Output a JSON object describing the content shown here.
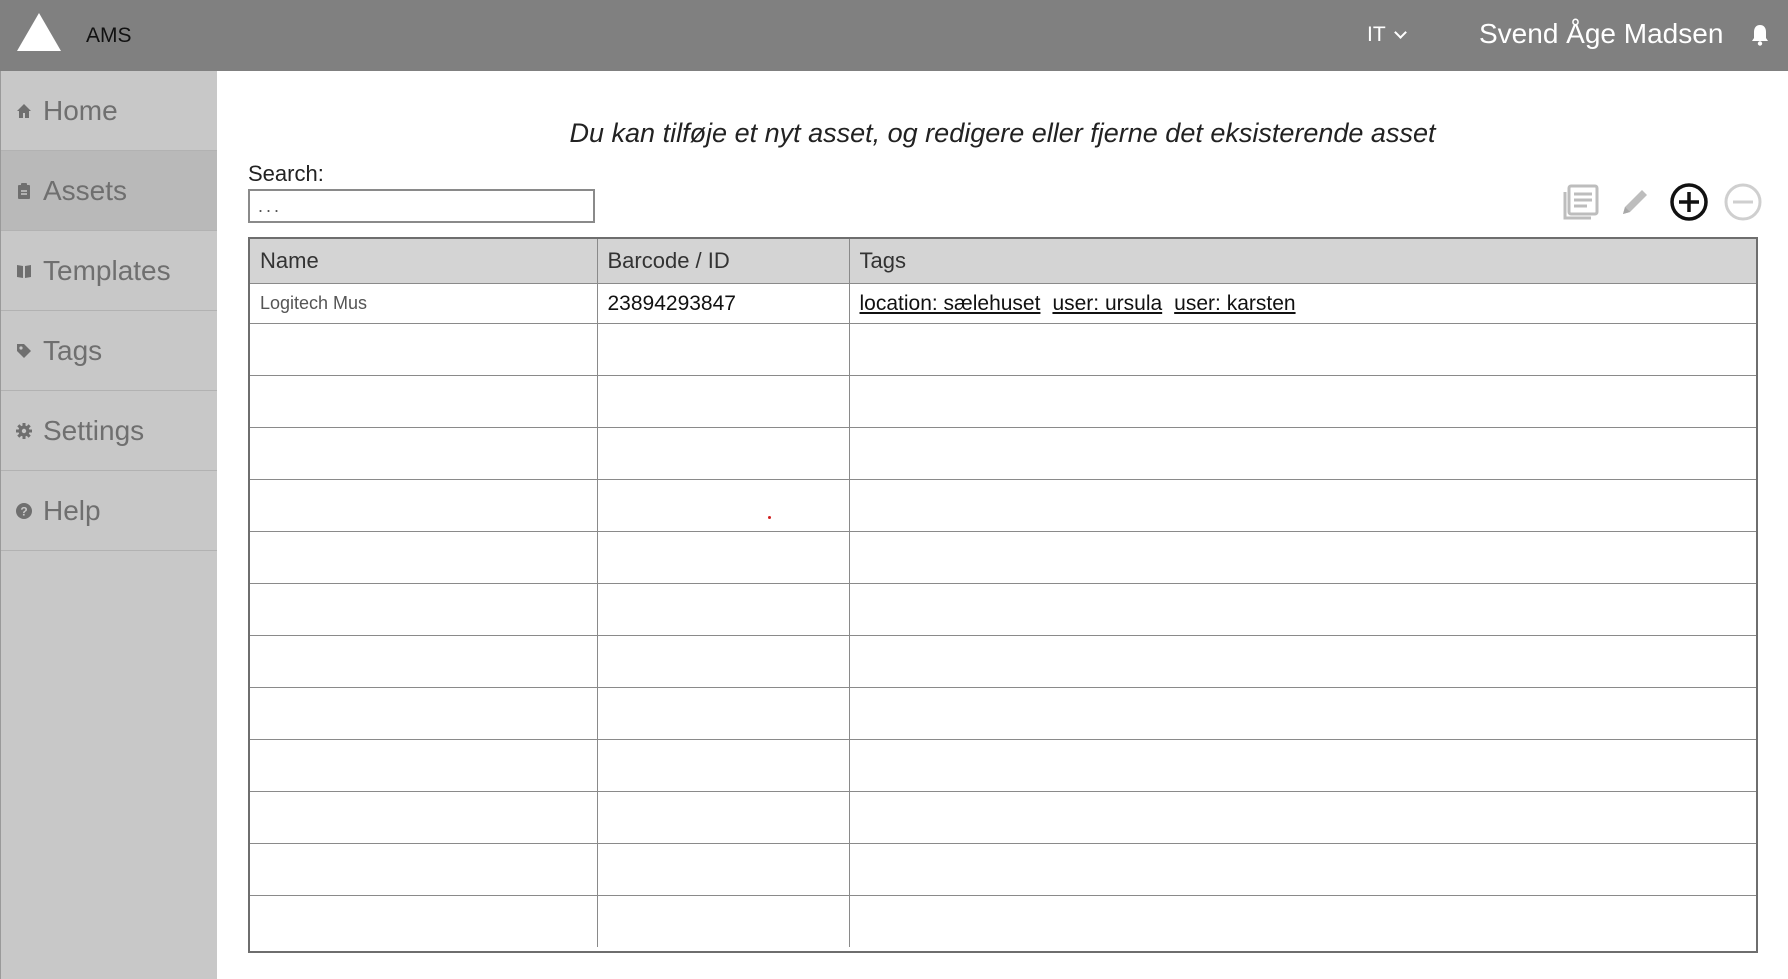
{
  "app": {
    "name": "AMS"
  },
  "header": {
    "department": "IT",
    "user_name": "Svend Åge Madsen"
  },
  "sidebar": {
    "items": [
      {
        "label": "Home",
        "icon": "home-icon",
        "active": false
      },
      {
        "label": "Assets",
        "icon": "clipboard-icon",
        "active": true
      },
      {
        "label": "Templates",
        "icon": "book-icon",
        "active": false
      },
      {
        "label": "Tags",
        "icon": "tag-icon",
        "active": false
      },
      {
        "label": "Settings",
        "icon": "gear-icon",
        "active": false
      },
      {
        "label": "Help",
        "icon": "help-icon",
        "active": false
      }
    ]
  },
  "main": {
    "subtitle": "Du kan tilføje et nyt asset, og redigere eller fjerne det eksisterende asset",
    "search_label": "Search:",
    "search_placeholder": "...",
    "toolbar": [
      "list-icon",
      "edit-icon",
      "add-icon",
      "remove-icon"
    ],
    "table": {
      "headers": [
        "Name",
        "Barcode / ID",
        "Tags"
      ],
      "rows": [
        {
          "name": "Logitech Mus",
          "barcode": "23894293847",
          "tags": [
            "location: sælehuset",
            "user: ursula",
            "user: karsten"
          ]
        }
      ],
      "empty_rows": 12
    }
  },
  "colors": {
    "header_bg": "#808080",
    "sidebar_bg": "#c8c8c8",
    "active_item": "#b9b9b9",
    "table_header": "#d4d4d4"
  }
}
